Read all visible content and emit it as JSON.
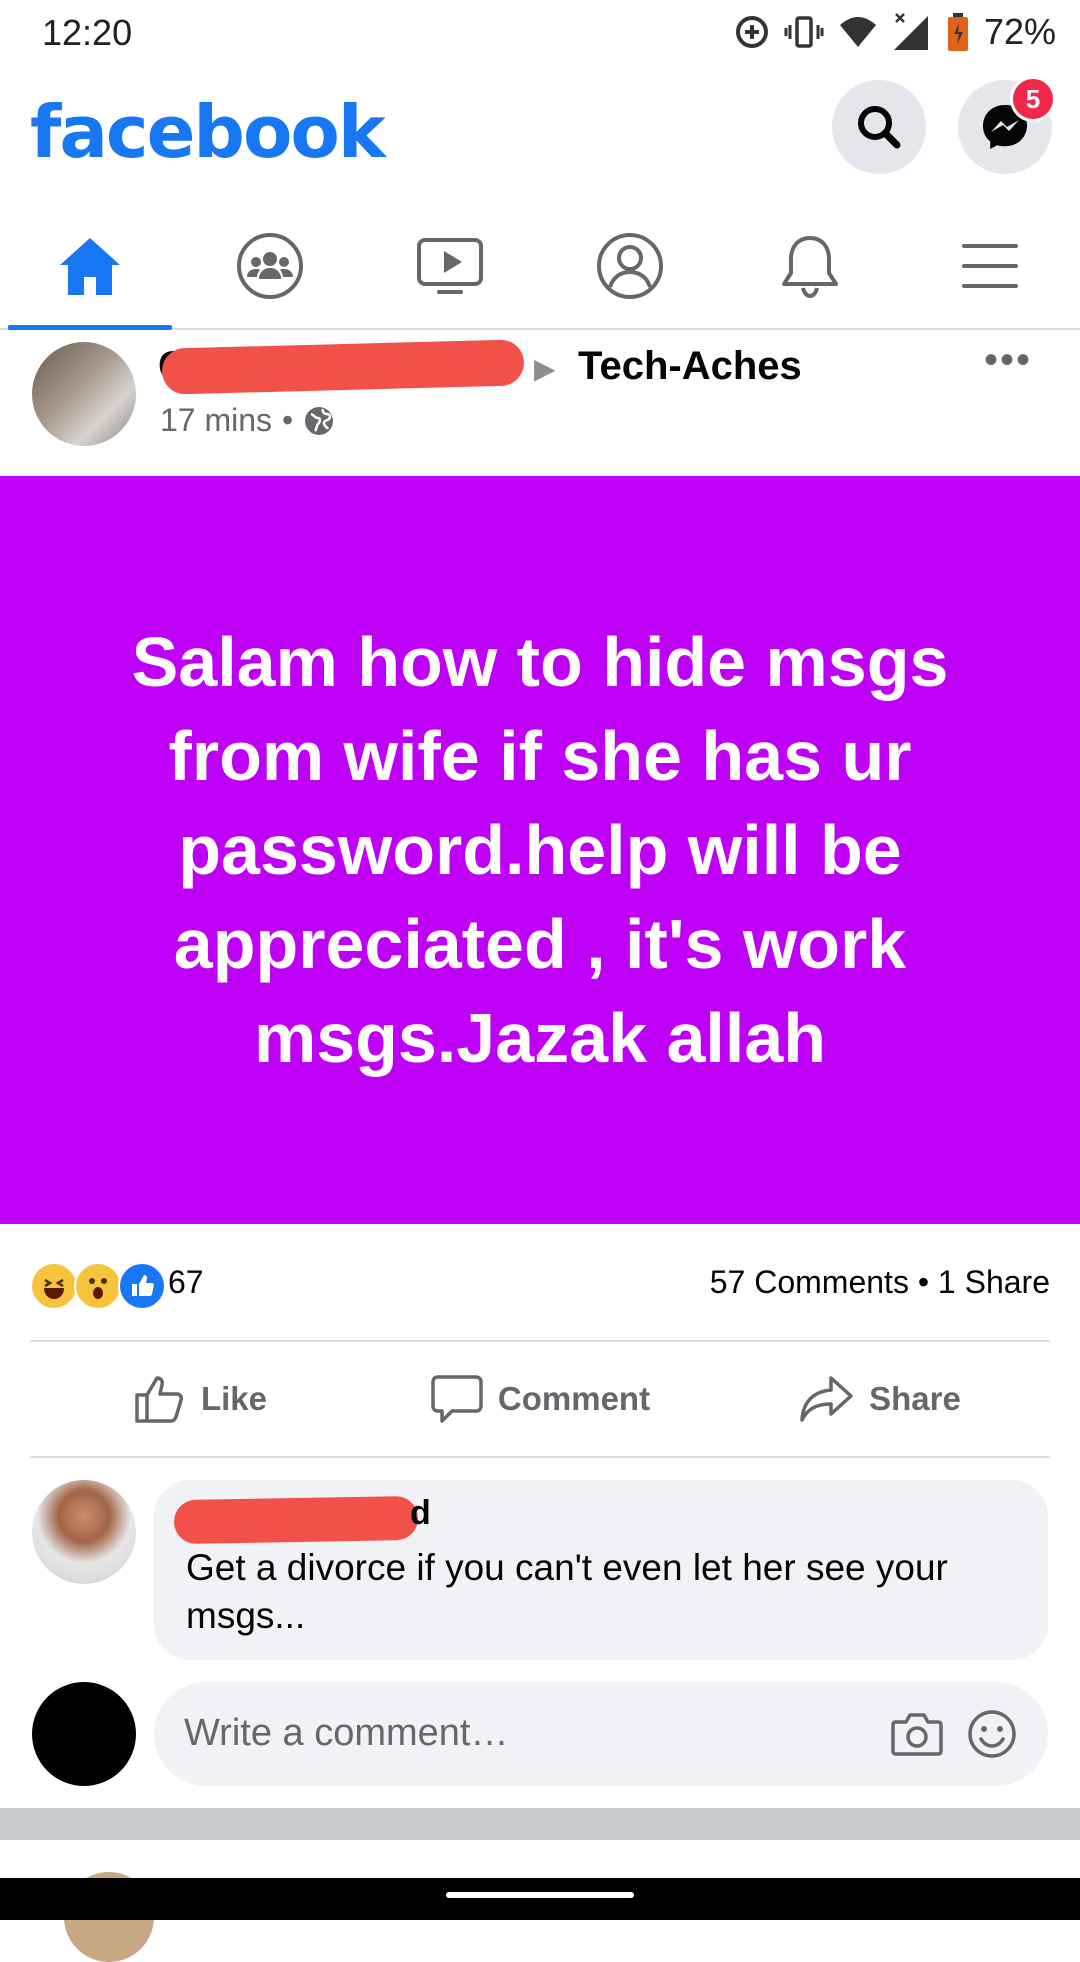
{
  "status_bar": {
    "time": "12:20",
    "battery": "72%"
  },
  "header": {
    "logo": "facebook",
    "messenger_badge": "5"
  },
  "nav_tabs": [
    "home",
    "groups",
    "watch",
    "profile",
    "notifications",
    "menu"
  ],
  "post": {
    "author_visible_initial": "C",
    "group": "Tech-Aches",
    "time": "17 mins",
    "dot": "•",
    "body": "Salam how to hide msgs from wife if she has ur password.help will be appreciated , it's work msgs.Jazak allah",
    "background_color": "#bf00f6",
    "reaction_count": "67",
    "comments": "57 Comments",
    "shares": "1 Share"
  },
  "actions": {
    "like": "Like",
    "comment": "Comment",
    "share": "Share"
  },
  "comment": {
    "name_end": "d",
    "text": "Get a divorce if you can't even let her see your msgs..."
  },
  "write_comment": {
    "placeholder": "Write a comment…"
  }
}
